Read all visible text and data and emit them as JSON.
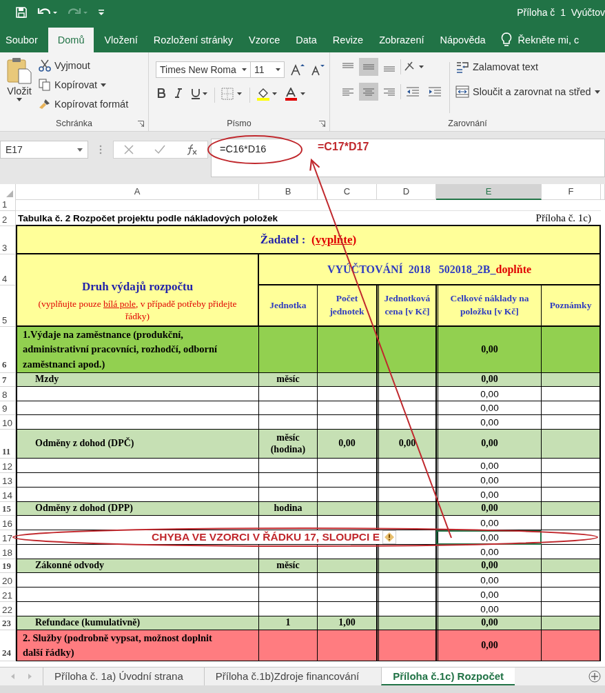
{
  "title_bar": {
    "title": "Příloha č  1  Vyúčtov"
  },
  "ribbon_tabs": [
    {
      "label": "Soubor",
      "selected": false
    },
    {
      "label": "Domů",
      "selected": true
    },
    {
      "label": "Vložení",
      "selected": false
    },
    {
      "label": "Rozložení stránky",
      "selected": false
    },
    {
      "label": "Vzorce",
      "selected": false
    },
    {
      "label": "Data",
      "selected": false
    },
    {
      "label": "Revize",
      "selected": false
    },
    {
      "label": "Zobrazení",
      "selected": false
    },
    {
      "label": "Nápověda",
      "selected": false
    }
  ],
  "tell_me": "Řekněte mi, c",
  "clipboard": {
    "paste": "Vložit",
    "cut": "Vyjmout",
    "copy": "Kopírovat",
    "format_painter": "Kopírovat formát",
    "group": "Schránka"
  },
  "font": {
    "name": "Times New Roma",
    "size": "11",
    "group": "Písmo"
  },
  "alignment": {
    "wrap": "Zalamovat text",
    "merge": "Sloučit a zarovnat na střed",
    "group": "Zarovnání"
  },
  "formula_bar": {
    "name_box": "E17",
    "formula": "=C16*D16"
  },
  "annotations": {
    "correct_formula": "=C17*D17",
    "error_note": "CHYBA VE VZORCI V ŘÁDKU 17, SLOUPCI E"
  },
  "columns": [
    {
      "label": "A",
      "selected": false
    },
    {
      "label": "B",
      "selected": false
    },
    {
      "label": "C",
      "selected": false
    },
    {
      "label": "D",
      "selected": false
    },
    {
      "label": "E",
      "selected": true
    },
    {
      "label": "F",
      "selected": false
    }
  ],
  "rows": [
    {
      "number": "1",
      "kind": "empty"
    },
    {
      "number": "2",
      "kind": "caption",
      "text": "Tabulka č. 2 Rozpočet projektu podle nákladových položek",
      "note": "Příloha č. 1c)"
    },
    {
      "number": "3",
      "kind": "applicant",
      "label": "Žadatel :",
      "value": "(vyplňte)"
    },
    {
      "numbers": [
        "4",
        "5"
      ],
      "kind": "header",
      "title": "Druh výdajů rozpočtu",
      "note_before": "(vyplňujte pouze ",
      "note_underlined": "bílá pole",
      "note_after": ", v případě potřeby přidejte řádky)",
      "report": "VYÚČTOVÁNÍ  2018   502018_2B_",
      "report_suffix": "doplňte",
      "headings": [
        "Jednotka",
        "Počet jednotek",
        "Jednotková cena [v Kč]",
        "Celkové náklady na položku [v Kč]",
        "Poznámky"
      ]
    },
    {
      "number": "6",
      "kind": "section",
      "color": "#92d050",
      "selected": false,
      "cells": {
        "label": "1.Výdaje na zaměstnance (produkční, administrativní pracovníci, rozhodčí, odborní zaměstnanci apod.)",
        "total": "0,00"
      }
    },
    {
      "number": "7",
      "kind": "subtotal",
      "selected": false,
      "cells": {
        "label": "Mzdy",
        "unit": "měsíc",
        "total": "0,00"
      }
    },
    {
      "number": "8",
      "kind": "item",
      "selected": false,
      "cells": {
        "total": "0,00"
      }
    },
    {
      "number": "9",
      "kind": "item",
      "selected": false,
      "cells": {
        "total": "0,00"
      }
    },
    {
      "number": "10",
      "kind": "item",
      "selected": false,
      "cells": {
        "total": "0,00"
      }
    },
    {
      "number": "11",
      "kind": "subtotal",
      "selected": false,
      "cells": {
        "label": "Odměny z dohod (DPČ)",
        "unit": "měsíc (hodina)",
        "count": "0,00",
        "price": "0,00",
        "total": "0,00"
      }
    },
    {
      "number": "12",
      "kind": "item",
      "selected": false,
      "cells": {
        "total": "0,00"
      }
    },
    {
      "number": "13",
      "kind": "item",
      "selected": false,
      "cells": {
        "total": "0,00"
      }
    },
    {
      "number": "14",
      "kind": "item",
      "selected": false,
      "cells": {
        "total": "0,00"
      }
    },
    {
      "number": "15",
      "kind": "subtotal",
      "selected": false,
      "cells": {
        "label": "Odměny z dohod (DPP)",
        "unit": "hodina",
        "total": "0,00"
      }
    },
    {
      "number": "16",
      "kind": "item",
      "selected": false,
      "cells": {
        "total": "0,00"
      }
    },
    {
      "number": "17",
      "kind": "item",
      "selected": true,
      "cells": {
        "total": "0,00"
      }
    },
    {
      "number": "18",
      "kind": "item",
      "selected": false,
      "cells": {
        "total": "0,00"
      }
    },
    {
      "number": "19",
      "kind": "subtotal",
      "selected": false,
      "cells": {
        "label": "Zákonné odvody",
        "unit": "měsíc",
        "total": "0,00"
      }
    },
    {
      "number": "20",
      "kind": "item",
      "selected": false,
      "cells": {
        "total": "0,00"
      }
    },
    {
      "number": "21",
      "kind": "item",
      "selected": false,
      "cells": {
        "total": "0,00"
      }
    },
    {
      "number": "22",
      "kind": "item",
      "selected": false,
      "cells": {
        "total": "0,00"
      }
    },
    {
      "number": "23",
      "kind": "subtotal",
      "selected": false,
      "cells": {
        "label": "Refundace (kumulativně)",
        "unit": "1",
        "count": "1,00",
        "total": "0,00"
      }
    },
    {
      "number": "24",
      "kind": "section",
      "color": "#ff7c80",
      "selected": false,
      "cells": {
        "label": "2. Služby (podrobně vypsat, možnost doplnit další řádky)",
        "total": "0,00"
      }
    }
  ],
  "sheet_tabs": [
    {
      "label": "Příloha č. 1a) Úvodní strana",
      "selected": false
    },
    {
      "label": "Příloha č.1b)Zdroje financování",
      "selected": false
    },
    {
      "label": "Příloha č.1c) Rozpočet",
      "selected": true
    }
  ]
}
